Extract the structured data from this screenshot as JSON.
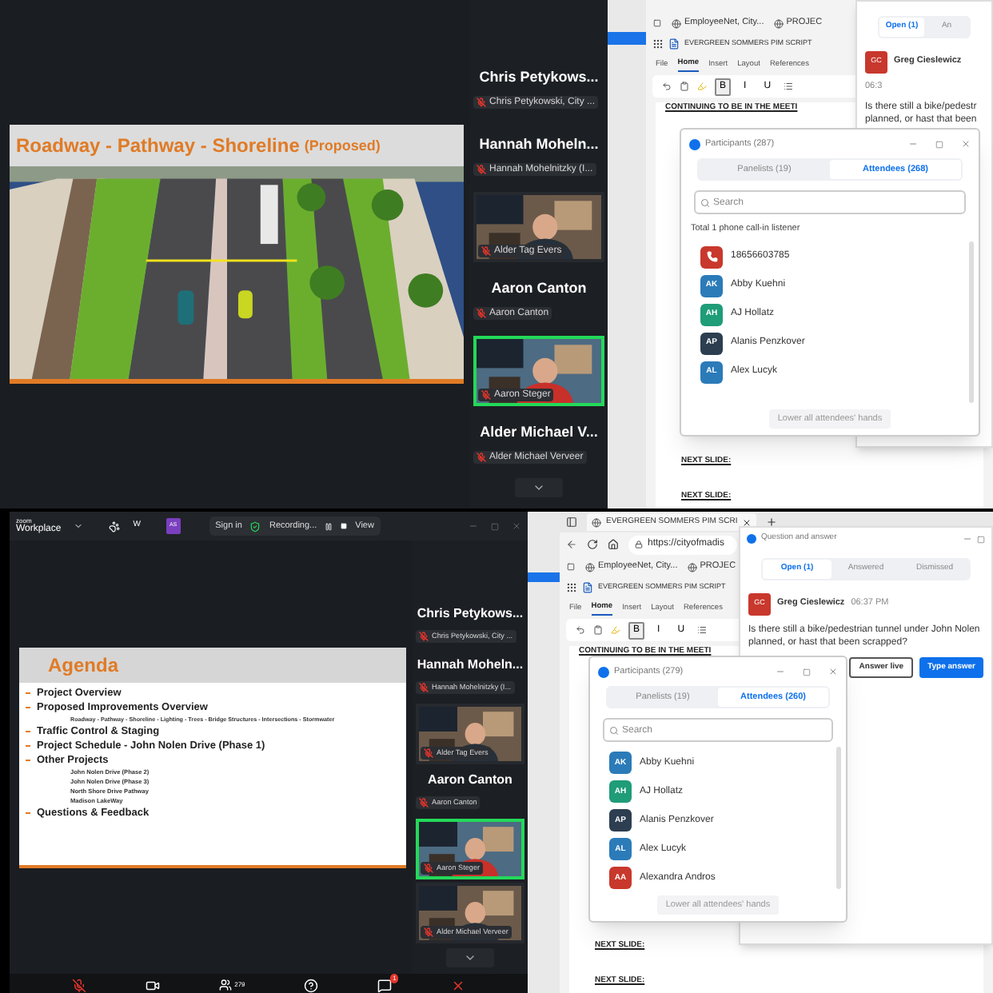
{
  "screens": [
    {
      "meeting": {
        "slide": {
          "title": "Roadway - Pathway - Shoreline",
          "note": "(Proposed)"
        },
        "gallery": [
          {
            "kind": "name",
            "name": "Chris Petykows...",
            "plate": "Chris Petykowski, City ..."
          },
          {
            "kind": "name",
            "name": "Hannah Moheln...",
            "plate": "Hannah Mohelnitzky (I..."
          },
          {
            "kind": "video",
            "plate": "Alder Tag Evers",
            "speaking": false
          },
          {
            "kind": "name",
            "name": "Aaron Canton",
            "plate": "Aaron Canton"
          },
          {
            "kind": "video",
            "plate": "Aaron Steger",
            "speaking": true
          },
          {
            "kind": "name",
            "name": "Alder Michael V...",
            "plate": "Alder Michael Verveer"
          }
        ]
      },
      "browser": {
        "bookmarks": [
          "EmployeeNet, City...",
          "PROJEC"
        ],
        "doc_title": "EVERGREEN SOMMERS PIM SCRIPT",
        "menu": [
          {
            "label": "File",
            "selected": false
          },
          {
            "label": "Home",
            "selected": true
          },
          {
            "label": "Insert",
            "selected": false
          },
          {
            "label": "Layout",
            "selected": false
          },
          {
            "label": "References",
            "selected": false
          }
        ],
        "format_buttons": [
          {
            "label": "B",
            "selected": true
          },
          {
            "label": "I",
            "selected": false
          },
          {
            "label": "U",
            "selected": false
          }
        ],
        "doc_lines": [
          "CONTINUING TO BE IN THE MEETI",
          "NEXT SLIDE:",
          "NEXT SLIDE:"
        ]
      },
      "qa": {
        "tabs": [
          {
            "label": "Open (1)",
            "selected": true
          },
          {
            "label": "An",
            "selected": false
          }
        ],
        "initials": "GC",
        "name": "Greg Cieslewicz",
        "time": "06:3",
        "question_lines": [
          "Is there still a bike/pedestr",
          "planned, or hast that been"
        ]
      },
      "participants": {
        "title": "Participants (287)",
        "tabs": [
          {
            "label": "Panelists (19)",
            "selected": false
          },
          {
            "label": "Attendees (268)",
            "selected": true
          }
        ],
        "placeholder": "Search",
        "note": "Total 1 phone call-in listener",
        "people": [
          {
            "kind": "phone",
            "name": "18656603785",
            "color": "#c8382c"
          },
          {
            "kind": "person",
            "initials": "AK",
            "name": "Abby Kuehni",
            "color": "#2b7bb9"
          },
          {
            "kind": "person",
            "initials": "AH",
            "name": "AJ Hollatz",
            "color": "#1f9c78"
          },
          {
            "kind": "person",
            "initials": "AP",
            "name": "Alanis Penzkover",
            "color": "#2c3e50"
          },
          {
            "kind": "person",
            "initials": "AL",
            "name": "Alex Lucyk",
            "color": "#2b7bb9"
          }
        ],
        "button": "Lower all attendees' hands"
      }
    },
    {
      "meeting": {
        "title_bar": {
          "logo_top": "zoom",
          "logo": "Workplace",
          "tab_letter": "W",
          "avatar": "AS",
          "sign_in": "Sign in",
          "recording": "Recording...",
          "view": "View"
        },
        "slide": {
          "kind": "agenda",
          "title": "Agenda",
          "items": [
            {
              "text": "Project Overview"
            },
            {
              "text": "Proposed Improvements Overview",
              "detail": "Roadway - Pathway - Shoreline - Lighting - Trees - Bridge Structures - Intersections - Stormwater"
            },
            {
              "text": "Traffic Control & Staging"
            },
            {
              "text": "Project Schedule - John Nolen Drive (Phase 1)"
            },
            {
              "text": "Other Projects",
              "children": [
                "John Nolen Drive (Phase 2)",
                "John Nolen Drive (Phase 3)",
                "North Shore Drive Pathway",
                "Madison LakeWay"
              ]
            },
            {
              "text": "Questions & Feedback"
            }
          ]
        },
        "gallery": [
          {
            "kind": "name",
            "name": "Chris Petykows...",
            "plate": "Chris Petykowski, City ..."
          },
          {
            "kind": "name",
            "name": "Hannah Moheln...",
            "plate": "Hannah Mohelnitzky (I..."
          },
          {
            "kind": "video",
            "plate": "Alder Tag Evers",
            "speaking": false
          },
          {
            "kind": "name",
            "name": "Aaron Canton",
            "plate": "Aaron Canton"
          },
          {
            "kind": "video",
            "plate": "Aaron Steger",
            "speaking": true
          },
          {
            "kind": "video",
            "plate": "Alder Michael Verveer",
            "speaking": false
          }
        ],
        "toolbar": {
          "participants_count": "279",
          "chat_badge": "1"
        }
      },
      "browser": {
        "tab": "EVERGREEN SOMMERS PIM SCRI",
        "url": "https://cityofmadis",
        "bookmarks": [
          "EmployeeNet, City...",
          "PROJEC"
        ],
        "doc_title": "EVERGREEN SOMMERS PIM SCRIPT",
        "menu": [
          {
            "label": "File",
            "selected": false
          },
          {
            "label": "Home",
            "selected": true
          },
          {
            "label": "Insert",
            "selected": false
          },
          {
            "label": "Layout",
            "selected": false
          },
          {
            "label": "References",
            "selected": false
          }
        ],
        "format_buttons": [
          {
            "label": "B",
            "selected": true
          },
          {
            "label": "I",
            "selected": false
          },
          {
            "label": "U",
            "selected": false
          }
        ],
        "doc_lines": [
          "CONTINUING TO BE IN THE MEETI",
          "NEXT SLIDE:",
          "NEXT SLIDE:"
        ]
      },
      "qa": {
        "title": "Question and answer",
        "tabs": [
          {
            "label": "Open (1)",
            "selected": true
          },
          {
            "label": "Answered",
            "selected": false
          },
          {
            "label": "Dismissed",
            "selected": false
          }
        ],
        "initials": "GC",
        "name": "Greg Cieslewicz",
        "time": "06:37 PM",
        "question_lines": [
          "Is there still a bike/pedestrian tunnel under John Nolen",
          "planned, or hast that been scrapped?"
        ],
        "buttons": [
          {
            "kind": "outline",
            "label": "Answer live"
          },
          {
            "kind": "primary",
            "label": "Type answer"
          }
        ]
      },
      "participants": {
        "title": "Participants (279)",
        "tabs": [
          {
            "label": "Panelists (19)",
            "selected": false
          },
          {
            "label": "Attendees (260)",
            "selected": true
          }
        ],
        "placeholder": "Search",
        "people": [
          {
            "kind": "person",
            "initials": "AK",
            "name": "Abby Kuehni",
            "color": "#2b7bb9"
          },
          {
            "kind": "person",
            "initials": "AH",
            "name": "AJ Hollatz",
            "color": "#1f9c78"
          },
          {
            "kind": "person",
            "initials": "AP",
            "name": "Alanis Penzkover",
            "color": "#2c3e50"
          },
          {
            "kind": "person",
            "initials": "AL",
            "name": "Alex Lucyk",
            "color": "#2b7bb9"
          },
          {
            "kind": "person",
            "initials": "AA",
            "name": "Alexandra Andros",
            "color": "#c8382c"
          }
        ],
        "button": "Lower all attendees' hands"
      }
    }
  ]
}
